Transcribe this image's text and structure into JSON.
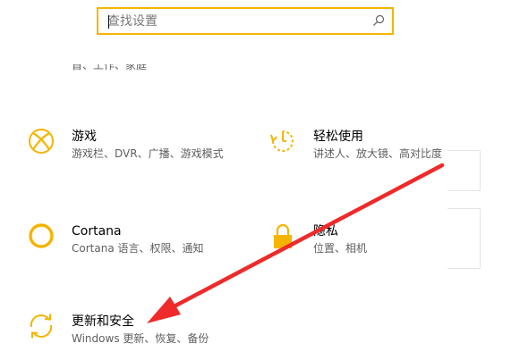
{
  "search": {
    "placeholder": "查找设置"
  },
  "clipped_row": {
    "desc": "首、工作、家庭"
  },
  "tiles": {
    "gaming": {
      "title": "游戏",
      "desc": "游戏栏、DVR、广播、游戏模式",
      "icon": "xbox-icon"
    },
    "ease": {
      "title": "轻松使用",
      "desc": "讲述人、放大镜、高对比度",
      "icon": "ease-of-access-timer-icon"
    },
    "cortana": {
      "title": "Cortana",
      "desc": "Cortana 语言、权限、通知",
      "icon": "cortana-circle-icon"
    },
    "privacy": {
      "title": "隐私",
      "desc": "位置、相机",
      "icon": "lock-icon"
    },
    "update": {
      "title": "更新和安全",
      "desc": "Windows 更新、恢复、备份",
      "icon": "sync-icon"
    }
  },
  "colors": {
    "accent": "#f5b400",
    "arrow": "#ee2a2a",
    "desc_text": "#5f5f5f"
  }
}
